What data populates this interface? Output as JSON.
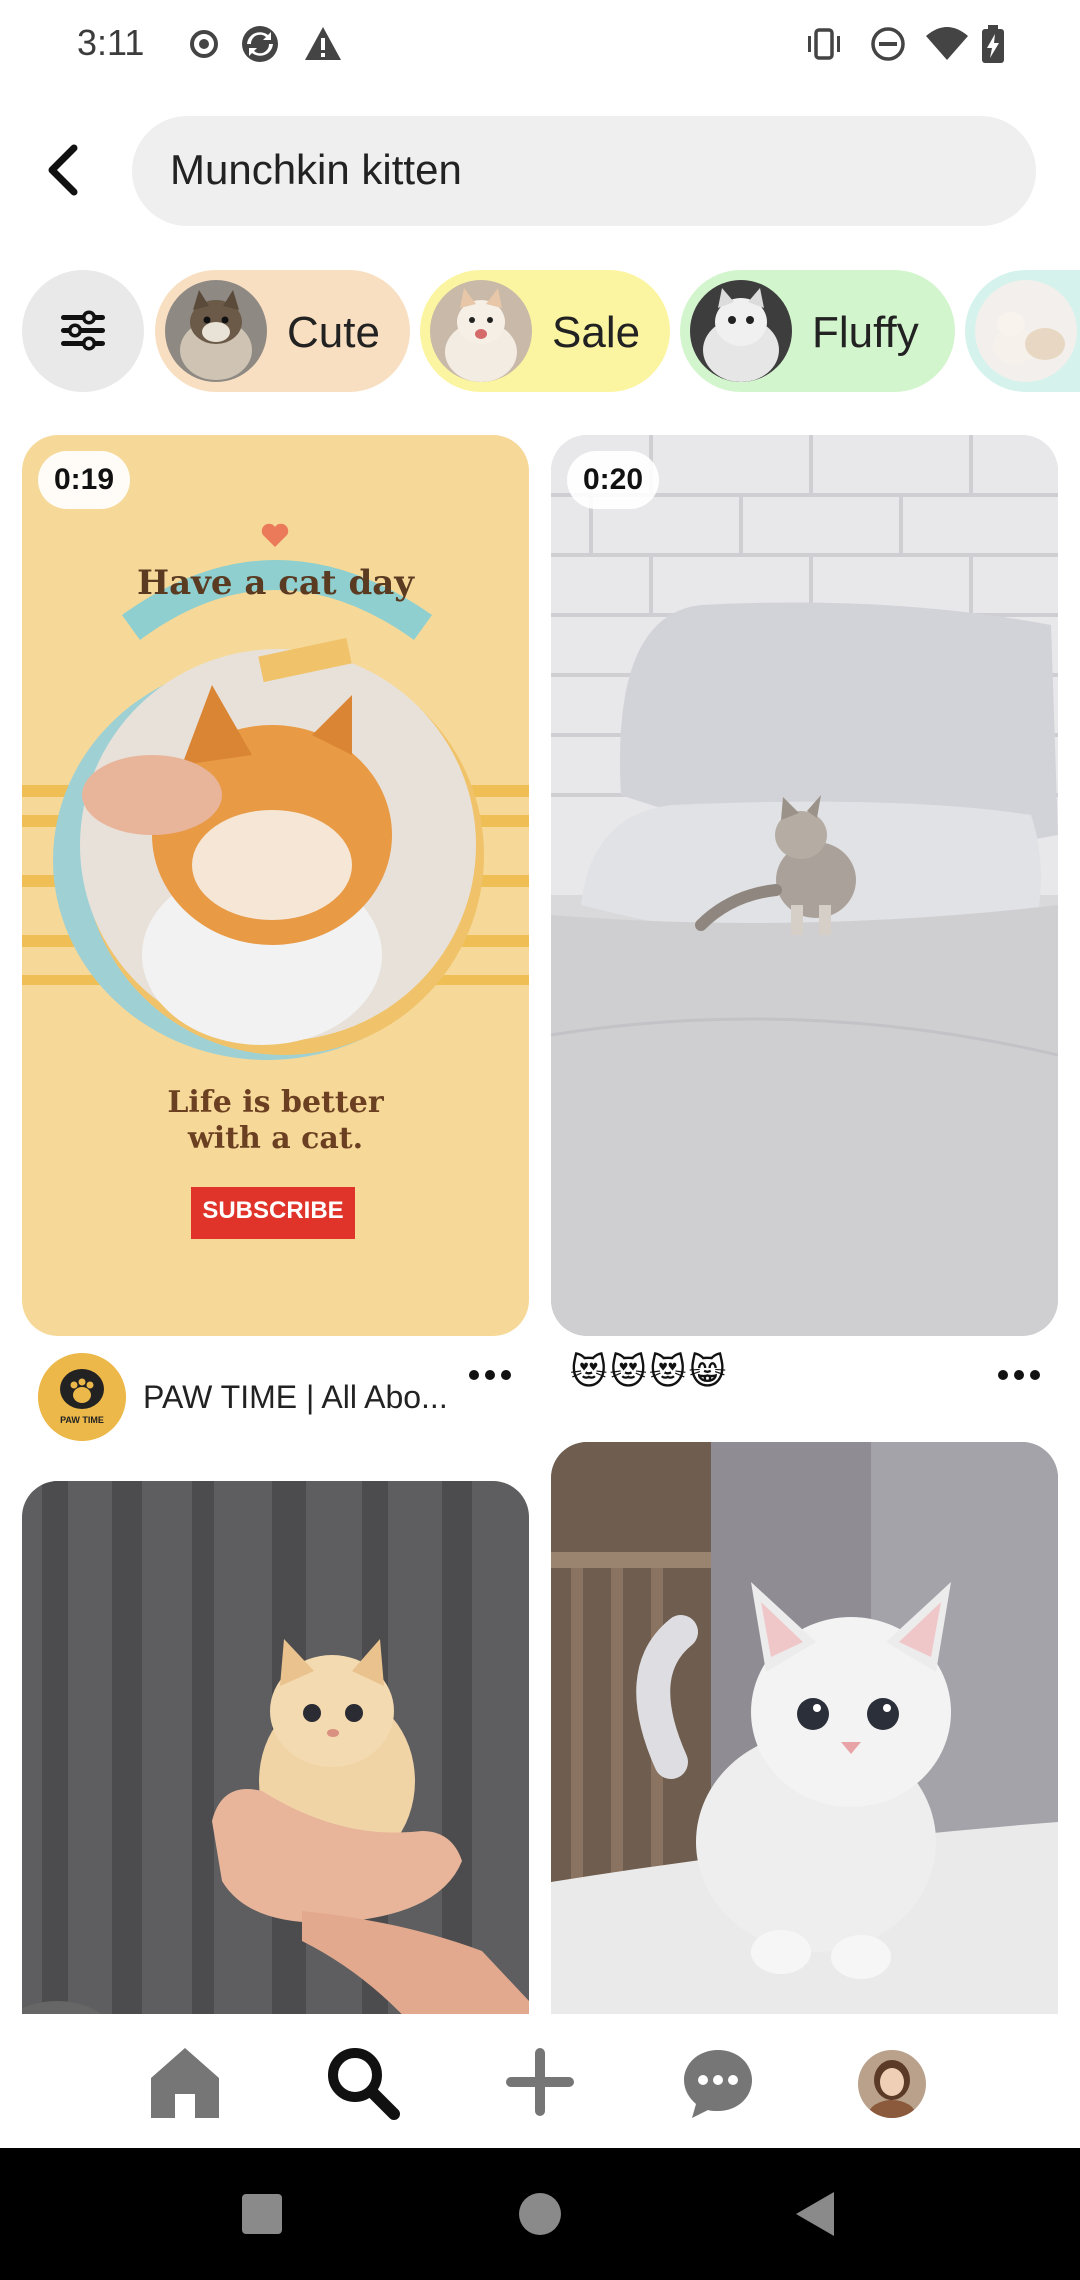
{
  "status_bar": {
    "time": "3:11",
    "left_icons": [
      "record-icon",
      "sync-icon",
      "alert-icon"
    ],
    "right_icons": [
      "vibrate-icon",
      "do-not-disturb-icon",
      "wifi-icon",
      "battery-charging-icon"
    ]
  },
  "search": {
    "query": "Munchkin kitten",
    "back_icon": "chevron-left-icon"
  },
  "chips": {
    "filter_icon": "sliders-icon",
    "items": [
      {
        "label": "Cute",
        "color": "#f9dfc1"
      },
      {
        "label": "Sale",
        "color": "#fbf5a2"
      },
      {
        "label": "Fluffy",
        "color": "#d3f5cd"
      },
      {
        "label": "",
        "color": "#d5f3ec"
      }
    ]
  },
  "pins": [
    {
      "duration": "0:19",
      "poster_title": "Have a cat day",
      "poster_text_line1": "Life is better",
      "poster_text_line2": "with a cat.",
      "poster_button": "SUBSCRIBE",
      "author": "PAW TIME | All Abo...",
      "avatar_text": "PAW TIME"
    },
    {
      "duration": "0:20",
      "caption": "😻😻😻😸"
    },
    {
      "description": "cream kitten held in hands"
    },
    {
      "description": "white munchkin kitten on blanket"
    }
  ],
  "bottom_nav": {
    "items": [
      "home-icon",
      "search-icon",
      "create-icon",
      "messages-icon",
      "profile-avatar"
    ]
  },
  "system_nav": [
    "recents-icon",
    "home-icon",
    "back-icon"
  ]
}
